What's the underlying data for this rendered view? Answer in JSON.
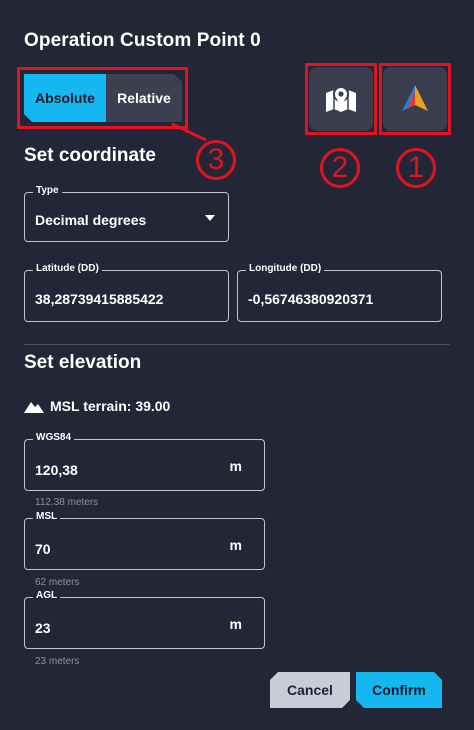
{
  "dialog": {
    "title": "Operation Custom Point 0"
  },
  "toggle": {
    "absolute_label": "Absolute",
    "relative_label": "Relative",
    "selected": "Absolute"
  },
  "icons": {
    "map_button": "map-pin-icon",
    "compass_button": "compass-arrow-icon"
  },
  "annotations": {
    "one": "1",
    "two": "2",
    "three": "3"
  },
  "coordinate": {
    "section_title": "Set coordinate",
    "type_label": "Type",
    "type_value": "Decimal degrees",
    "latitude_label": "Latitude (DD)",
    "latitude_value": "38,28739415885422",
    "longitude_label": "Longitude (DD)",
    "longitude_value": "-0,56746380920371"
  },
  "elevation": {
    "section_title": "Set elevation",
    "terrain_text": "MSL terrain: 39.00",
    "wgs84": {
      "label": "WGS84",
      "value": "120,38",
      "unit": "m",
      "helper": "112.38 meters"
    },
    "msl": {
      "label": "MSL",
      "value": "70",
      "unit": "m",
      "helper": "62 meters"
    },
    "agl": {
      "label": "AGL",
      "value": "23",
      "unit": "m",
      "helper": "23 meters"
    }
  },
  "actions": {
    "cancel_label": "Cancel",
    "confirm_label": "Confirm"
  },
  "colors": {
    "background": "#232637",
    "accent": "#14b7ef",
    "annotation_red": "#e0141e",
    "button_gray": "#3a3d4e"
  }
}
